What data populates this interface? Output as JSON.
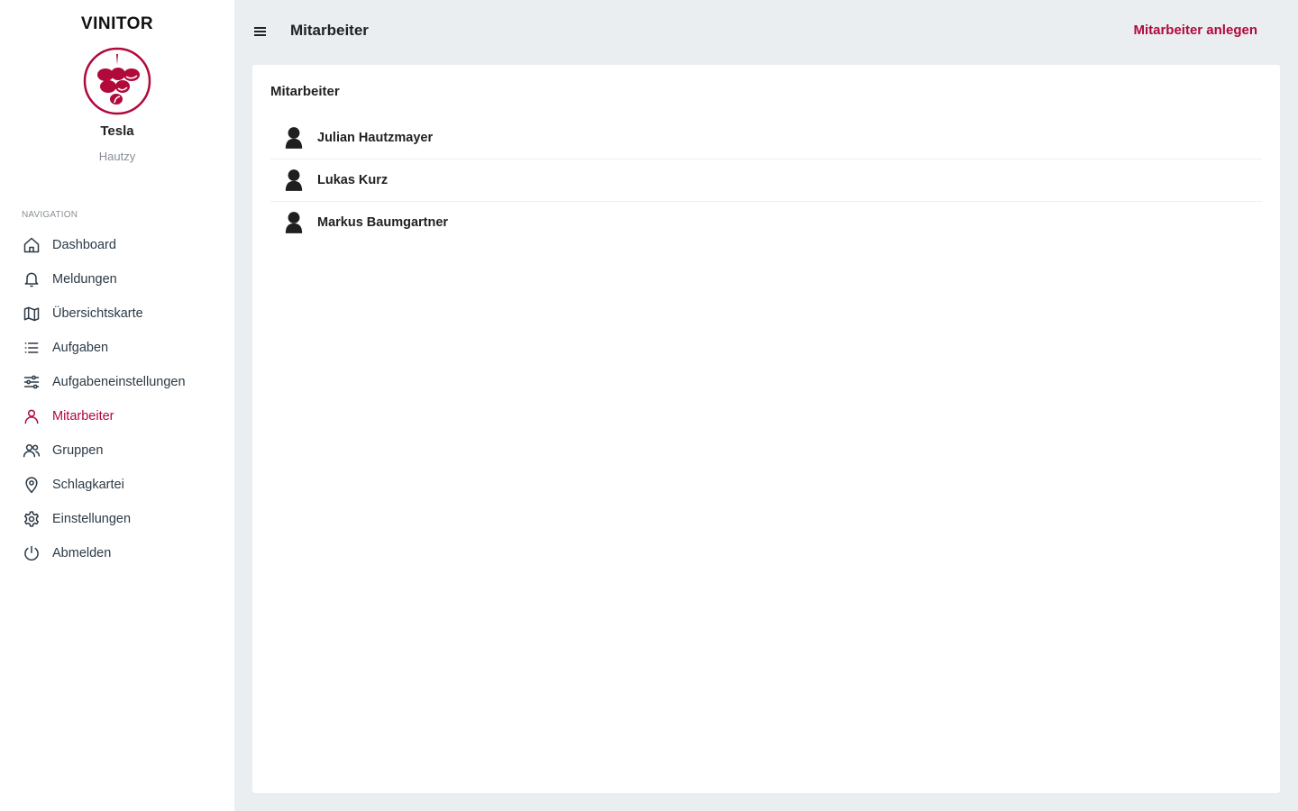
{
  "app": {
    "brand": "VINITOR",
    "company": "Tesla",
    "user": "Hautzy",
    "accent_color": "#b0093a"
  },
  "sidebar": {
    "heading": "NAVIGATION",
    "items": [
      {
        "label": "Dashboard",
        "icon": "home-icon",
        "active": false
      },
      {
        "label": "Meldungen",
        "icon": "bell-icon",
        "active": false
      },
      {
        "label": "Übersichtskarte",
        "icon": "map-icon",
        "active": false
      },
      {
        "label": "Aufgaben",
        "icon": "list-icon",
        "active": false
      },
      {
        "label": "Aufgabeneinstellungen",
        "icon": "sliders-icon",
        "active": false
      },
      {
        "label": "Mitarbeiter",
        "icon": "user-icon",
        "active": true
      },
      {
        "label": "Gruppen",
        "icon": "users-icon",
        "active": false
      },
      {
        "label": "Schlagkartei",
        "icon": "map-pin-icon",
        "active": false
      },
      {
        "label": "Einstellungen",
        "icon": "gear-icon",
        "active": false
      },
      {
        "label": "Abmelden",
        "icon": "power-icon",
        "active": false
      }
    ]
  },
  "header": {
    "title": "Mitarbeiter",
    "action_label": "Mitarbeiter anlegen",
    "menu_icon": "hamburger-menu-icon"
  },
  "card": {
    "title": "Mitarbeiter",
    "employees": [
      {
        "name": "Julian Hautzmayer"
      },
      {
        "name": "Lukas Kurz"
      },
      {
        "name": "Markus Baumgartner"
      }
    ]
  }
}
